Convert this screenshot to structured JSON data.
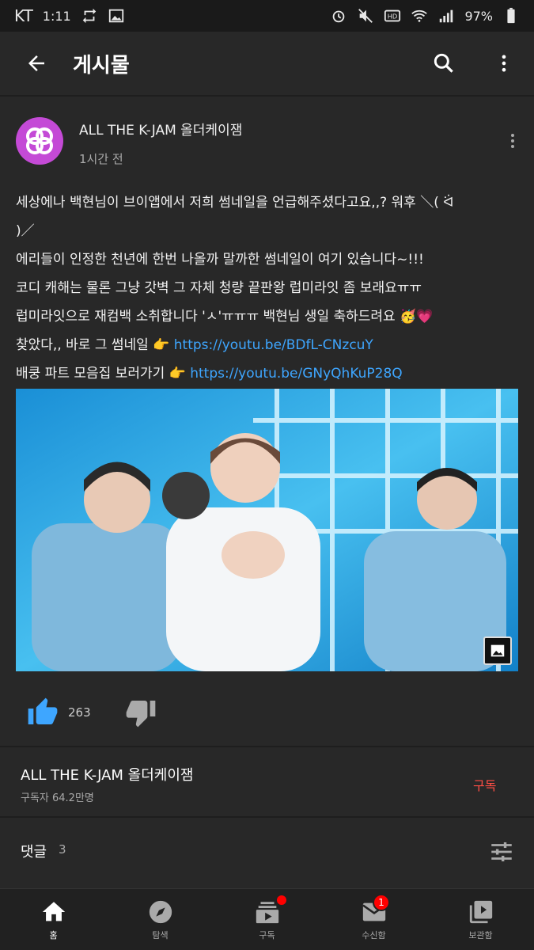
{
  "status_bar": {
    "carrier": "KT",
    "time": "1:11",
    "battery": "97%"
  },
  "appbar": {
    "title": "게시물"
  },
  "post": {
    "channel_name": "ALL THE K-JAM 올더케이잼",
    "time": "1시간 전",
    "lines": [
      "세상에나 백현님이 브이앱에서 저희 썸네일을 언급해주셨다고요,,? 워후 ＼( ᐛ",
      ")／",
      "에리들이 인정한 천년에 한번 나올까 말까한 썸네일이 여기 있습니다~!!!",
      "코디 캐해는 물론 그냥 갓벽 그 자체 청량 끝판왕 럽미라잇 좀 보래요ㅠㅠ",
      "럽미라잇으로 재컴백 소취합니다 'ㅅ'ㅠㅠㅠ 백현님 생일 축하드려요 🥳💗"
    ],
    "link_line_1_prefix": "찾았다,, 바로 그 썸네일 👉 ",
    "link_1": "https://youtu.be/BDfL-CNzcuY",
    "link_line_2_prefix": "배쿵 파트 모음집 보러가기 👉 ",
    "link_2": "https://youtu.be/GNyQhKuP28Q",
    "like_count": "263"
  },
  "channel": {
    "name": "ALL THE K-JAM 올더케이잼",
    "subscribers": "구독자 64.2만명",
    "subscribe_label": "구독"
  },
  "comments": {
    "label": "댓글",
    "count": "3"
  },
  "nav": [
    {
      "label": "홈",
      "icon": "home-icon"
    },
    {
      "label": "탐색",
      "icon": "explore-icon"
    },
    {
      "label": "구독",
      "icon": "subscriptions-icon"
    },
    {
      "label": "수신함",
      "icon": "inbox-icon",
      "badge": "1"
    },
    {
      "label": "보관함",
      "icon": "library-icon"
    }
  ],
  "colors": {
    "background": "#282828",
    "link": "#3ea6ff",
    "like_active": "#3ea6ff",
    "subscribe": "#ff4e45",
    "badge": "#ff0000"
  }
}
